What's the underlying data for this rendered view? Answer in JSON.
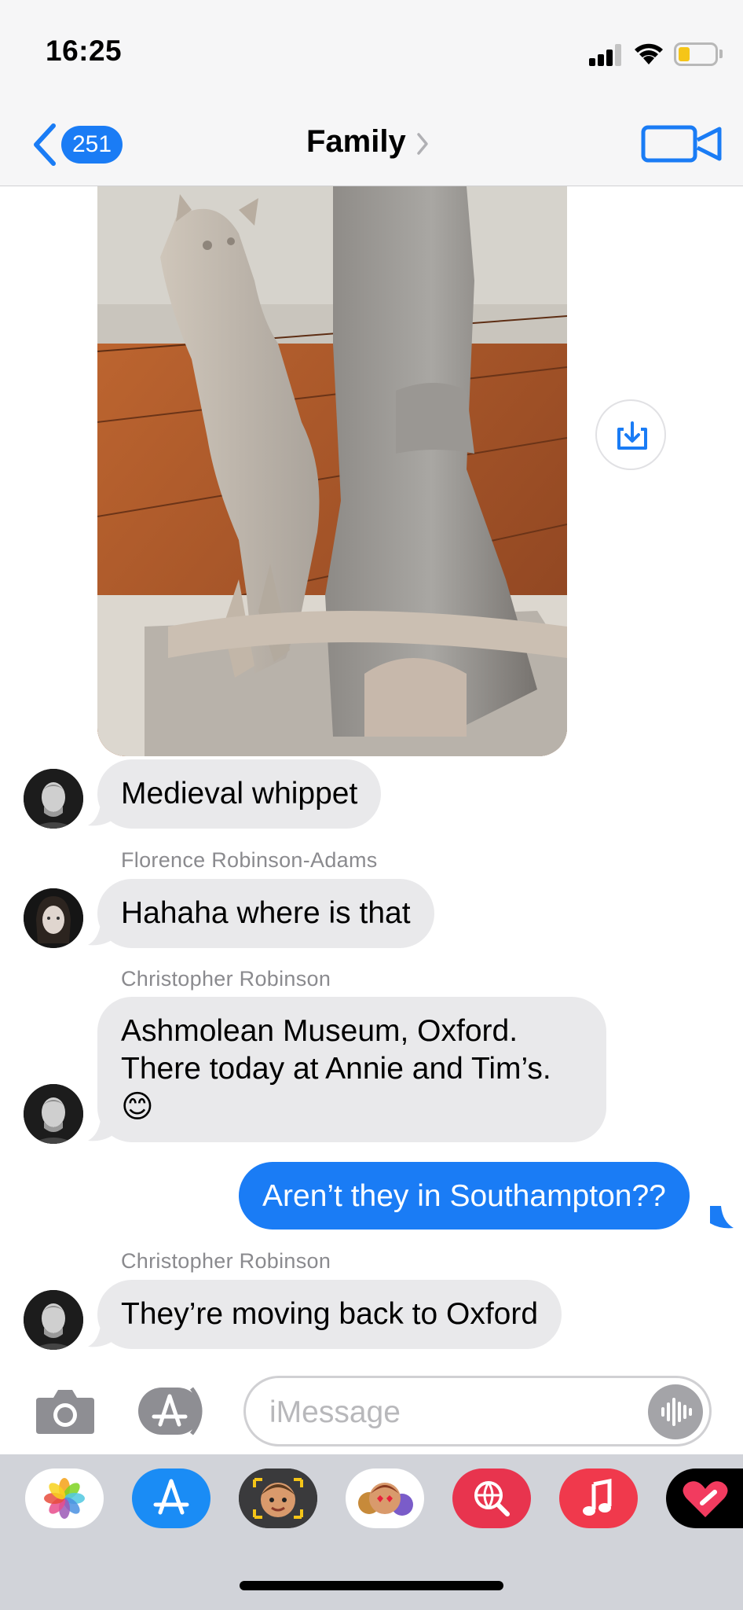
{
  "status_bar": {
    "time": "16:25",
    "icons": [
      "signal-icon",
      "wifi-icon",
      "battery-icon"
    ]
  },
  "nav": {
    "back_count": "251",
    "title": "Family",
    "icons": [
      "chevron-left-icon",
      "chevron-right-icon",
      "video-camera-icon"
    ]
  },
  "conversation": {
    "messages": [
      {
        "direction": "incoming",
        "text": "Medieval whippet"
      },
      {
        "direction": "incoming",
        "sender": "Florence Robinson-Adams",
        "text": "Hahaha where is that"
      },
      {
        "direction": "incoming",
        "sender": "Christopher Robinson",
        "lines": [
          "Ashmolean Museum, Oxford.",
          "There today at Annie and Tim’s."
        ],
        "emoji": "😊"
      },
      {
        "direction": "outgoing",
        "text": "Aren’t they in Southampton??"
      },
      {
        "direction": "incoming",
        "sender": "Christopher Robinson",
        "text": "They’re moving back to Oxford"
      }
    ]
  },
  "input_bar": {
    "placeholder": "iMessage",
    "icons": [
      "camera-icon",
      "app-store-icon",
      "audio-waveform-icon"
    ]
  },
  "app_drawer": {
    "apps": [
      "Photos",
      "App Store",
      "Memoji",
      "Animoji",
      "Search Images",
      "Music",
      "Digital Touch"
    ]
  },
  "colors": {
    "accent": "#1a7cf5",
    "incoming_bubble": "#e9e9eb",
    "sender_label": "#8a8a8e",
    "bar_background": "#f6f6f7",
    "drawer_background": "#d1d3d9"
  }
}
